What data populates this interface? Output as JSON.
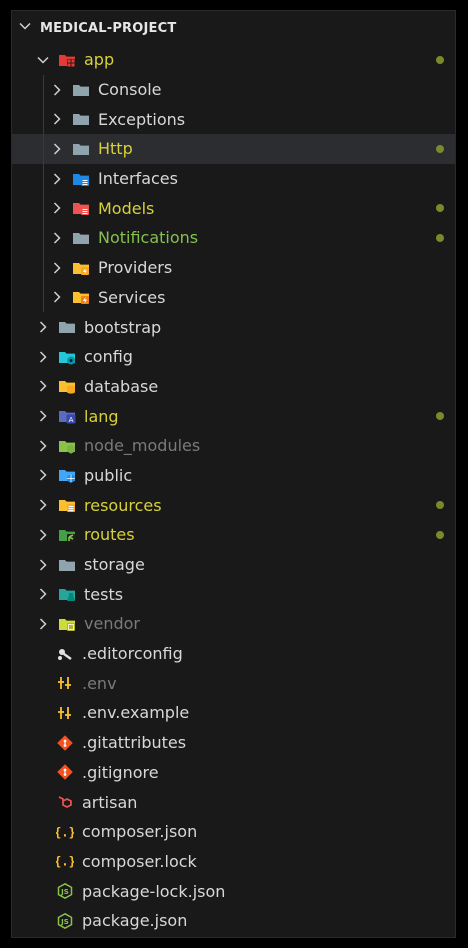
{
  "explorer": {
    "title": "MEDICAL-PROJECT"
  },
  "colors": {
    "background": "#191919",
    "modified_text": "#d7d13a",
    "untracked_text": "#86c04e",
    "ignored_text": "#7a7a7a",
    "badge_dot": "#7a8a2a"
  },
  "tree": [
    {
      "name": "app",
      "kind": "folder",
      "expanded": true,
      "icon": "folder-app-icon",
      "status": "modified",
      "badge": true
    },
    {
      "name": "Console",
      "kind": "folder",
      "icon": "folder-icon",
      "status": "",
      "badge": false
    },
    {
      "name": "Exceptions",
      "kind": "folder",
      "icon": "folder-icon",
      "status": "",
      "badge": false
    },
    {
      "name": "Http",
      "kind": "folder",
      "icon": "folder-icon",
      "status": "modified",
      "badge": true,
      "selected": true
    },
    {
      "name": "Interfaces",
      "kind": "folder",
      "icon": "folder-interfaces-icon",
      "status": "",
      "badge": false
    },
    {
      "name": "Models",
      "kind": "folder",
      "icon": "folder-models-icon",
      "status": "modified",
      "badge": true
    },
    {
      "name": "Notifications",
      "kind": "folder",
      "icon": "folder-icon",
      "status": "untracked",
      "badge": true
    },
    {
      "name": "Providers",
      "kind": "folder",
      "icon": "folder-providers-icon",
      "status": "",
      "badge": false
    },
    {
      "name": "Services",
      "kind": "folder",
      "icon": "folder-services-icon",
      "status": "",
      "badge": false
    },
    {
      "name": "bootstrap",
      "kind": "folder",
      "icon": "folder-icon",
      "status": "",
      "badge": false
    },
    {
      "name": "config",
      "kind": "folder",
      "icon": "folder-config-icon",
      "status": "",
      "badge": false
    },
    {
      "name": "database",
      "kind": "folder",
      "icon": "folder-database-icon",
      "status": "",
      "badge": false
    },
    {
      "name": "lang",
      "kind": "folder",
      "icon": "folder-lang-icon",
      "status": "modified",
      "badge": true
    },
    {
      "name": "node_modules",
      "kind": "folder",
      "icon": "folder-node-icon",
      "status": "ignored",
      "badge": false
    },
    {
      "name": "public",
      "kind": "folder",
      "icon": "folder-public-icon",
      "status": "",
      "badge": false
    },
    {
      "name": "resources",
      "kind": "folder",
      "icon": "folder-resources-icon",
      "status": "modified",
      "badge": true
    },
    {
      "name": "routes",
      "kind": "folder",
      "icon": "folder-routes-icon",
      "status": "modified",
      "badge": true
    },
    {
      "name": "storage",
      "kind": "folder",
      "icon": "folder-icon",
      "status": "",
      "badge": false
    },
    {
      "name": "tests",
      "kind": "folder",
      "icon": "folder-tests-icon",
      "status": "",
      "badge": false
    },
    {
      "name": "vendor",
      "kind": "folder",
      "icon": "folder-vendor-icon",
      "status": "ignored",
      "badge": false
    },
    {
      "name": ".editorconfig",
      "kind": "file",
      "icon": "editorconfig-icon",
      "status": "",
      "badge": false
    },
    {
      "name": ".env",
      "kind": "file",
      "icon": "env-icon",
      "status": "ignored",
      "badge": false
    },
    {
      "name": ".env.example",
      "kind": "file",
      "icon": "env-icon",
      "status": "",
      "badge": false
    },
    {
      "name": ".gitattributes",
      "kind": "file",
      "icon": "git-icon",
      "status": "",
      "badge": false
    },
    {
      "name": ".gitignore",
      "kind": "file",
      "icon": "git-icon",
      "status": "",
      "badge": false
    },
    {
      "name": "artisan",
      "kind": "file",
      "icon": "laravel-icon",
      "status": "",
      "badge": false
    },
    {
      "name": "composer.json",
      "kind": "file",
      "icon": "json-icon",
      "status": "",
      "badge": false
    },
    {
      "name": "composer.lock",
      "kind": "file",
      "icon": "json-icon",
      "status": "",
      "badge": false
    },
    {
      "name": "package-lock.json",
      "kind": "file",
      "icon": "nodejs-icon",
      "status": "",
      "badge": false
    },
    {
      "name": "package.json",
      "kind": "file",
      "icon": "nodejs-icon",
      "status": "",
      "badge": false
    }
  ]
}
